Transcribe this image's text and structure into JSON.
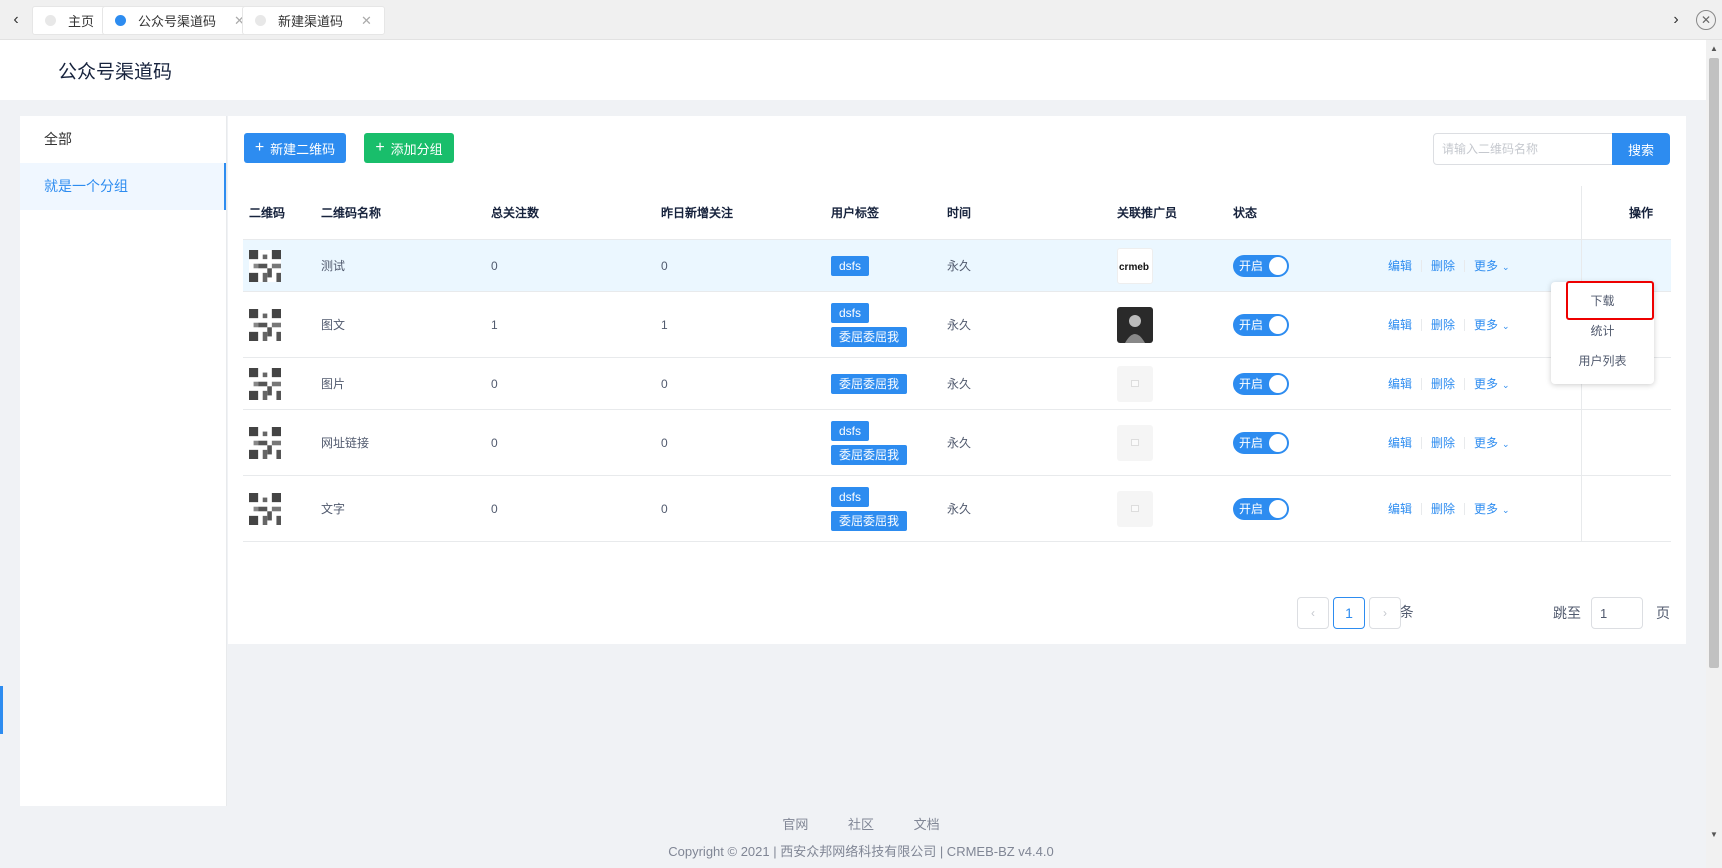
{
  "tabs": [
    {
      "label": "主页",
      "active": false
    },
    {
      "label": "公众号渠道码",
      "active": true
    },
    {
      "label": "新建渠道码",
      "active": false
    }
  ],
  "page": {
    "title": "公众号渠道码"
  },
  "sidebar": {
    "items": [
      {
        "label": "全部",
        "active": false
      },
      {
        "label": "就是一个分组",
        "active": true
      }
    ]
  },
  "toolbar": {
    "new_qrcode_label": "新建二维码",
    "add_group_label": "添加分组",
    "search_placeholder": "请输入二维码名称",
    "search_label": "搜索"
  },
  "table": {
    "headers": {
      "qrcode": "二维码",
      "name": "二维码名称",
      "total_follow": "总关注数",
      "yesterday_follow": "昨日新增关注",
      "tags": "用户标签",
      "time": "时间",
      "promoter": "关联推广员",
      "status": "状态",
      "ops": "操作"
    },
    "rows": [
      {
        "name": "测试",
        "total": "0",
        "yesterday": "0",
        "tags": [
          "dsfs"
        ],
        "time": "永久",
        "avatar": "crmeb-logo",
        "status": "开启"
      },
      {
        "name": "图文",
        "total": "1",
        "yesterday": "1",
        "tags": [
          "dsfs",
          "委屈委屈我"
        ],
        "time": "永久",
        "avatar": "photo",
        "status": "开启"
      },
      {
        "name": "图片",
        "total": "0",
        "yesterday": "0",
        "tags": [
          "委屈委屈我"
        ],
        "time": "永久",
        "avatar": "placeholder",
        "status": "开启"
      },
      {
        "name": "网址链接",
        "total": "0",
        "yesterday": "0",
        "tags": [
          "dsfs",
          "委屈委屈我"
        ],
        "time": "永久",
        "avatar": "placeholder",
        "status": "开启"
      },
      {
        "name": "文字",
        "total": "0",
        "yesterday": "0",
        "tags": [
          "dsfs",
          "委屈委屈我"
        ],
        "time": "永久",
        "avatar": "placeholder",
        "status": "开启"
      }
    ],
    "ops": {
      "edit": "编辑",
      "delete": "删除",
      "more": "更多"
    }
  },
  "dropdown": {
    "items": [
      "下载",
      "统计",
      "用户列表"
    ]
  },
  "pagination": {
    "total_label": "共 5 条",
    "current": "1",
    "jump_label": "跳至",
    "jump_value": "1",
    "unit": "页"
  },
  "footer": {
    "links": [
      "官网",
      "社区",
      "文档"
    ],
    "copyright": "Copyright © 2021 | 西安众邦网络科技有限公司 | CRMEB-BZ v4.4.0"
  },
  "colors": {
    "primary": "#2d8cf0",
    "success": "#19be6b",
    "highlight": "#e00000"
  }
}
